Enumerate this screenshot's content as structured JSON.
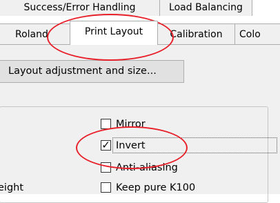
{
  "tabs_row1": [
    {
      "label": "Success/Error Handling"
    },
    {
      "label": "Load Balancing"
    }
  ],
  "tabs_row2": [
    {
      "label": "Roland"
    },
    {
      "label": "Print Layout"
    },
    {
      "label": "Calibration"
    },
    {
      "label": "Colo"
    }
  ],
  "layout_button_label": "Layout adjustment and size...",
  "partial_label": "eight",
  "options": [
    {
      "label": "Mirror",
      "checked": false
    },
    {
      "label": "Invert",
      "checked": true
    },
    {
      "label": "Anti-aliasing",
      "checked": false
    },
    {
      "label": "Keep pure K100",
      "checked": false
    }
  ],
  "colors": {
    "highlight_ring": "#e8202a",
    "panel": "#f0f0f0"
  }
}
